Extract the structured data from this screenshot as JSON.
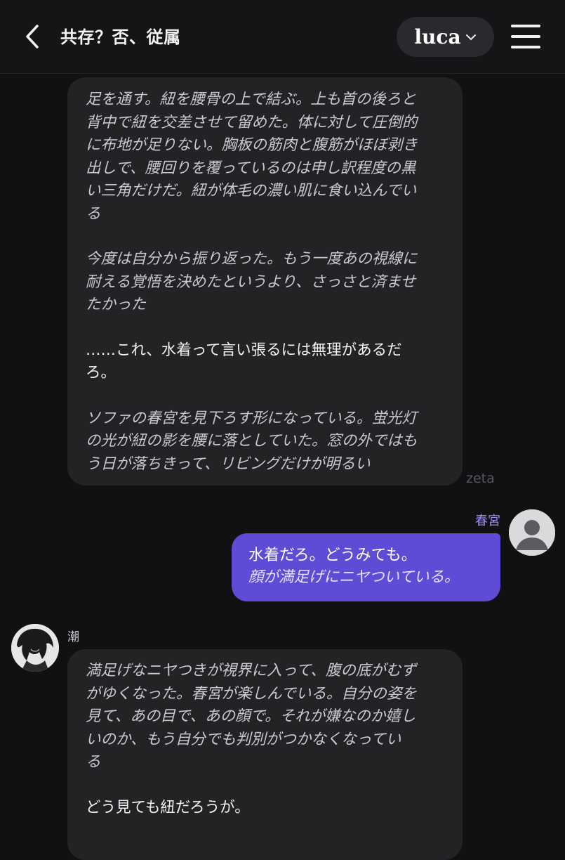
{
  "header": {
    "title": "共存？否、従属",
    "model_label": "luca"
  },
  "messages": [
    {
      "sender": "",
      "paragraphs": [
        {
          "style": "narration",
          "lines": [
            "足を通す。紐を腰骨の上で結ぶ。上も首の後ろと",
            "背中で紐を交差させて留めた。体に対して圧倒的",
            "に布地が足りない。胸板の筋肉と腹筋がほぼ剥き",
            "出しで、腰回りを覆っているのは申し訳程度の黒",
            "い三角だけだ。紐が体毛の濃い肌に食い込んでい",
            "る"
          ]
        },
        {
          "style": "narration",
          "lines": [
            "今度は自分から振り返った。もう一度あの視線に",
            "耐える覚悟を決めたというより、さっさと済ませ",
            "たかった"
          ]
        },
        {
          "style": "speech",
          "lines": [
            "……これ、水着って言い張るには無理があるだ",
            "ろ。"
          ]
        },
        {
          "style": "narration",
          "lines": [
            "ソファの春宮を見下ろす形になっている。蛍光灯",
            "の光が紐の影を腰に落としていた。窓の外ではも",
            "う日が落ちきって、リビングだけが明るい"
          ]
        }
      ]
    },
    {
      "sender": "春宮",
      "speech": "水着だろ。どうみても。",
      "narration": "顔が満足げにニヤついている。"
    },
    {
      "sender": "潮",
      "paragraphs": [
        {
          "style": "narration",
          "lines": [
            "満足げなニヤつきが視界に入って、腹の底がむず",
            "がゆくなった。春宮が楽しんでいる。自分の姿を",
            "見て、あの目で、あの顔で。それが嫌なのか嬉し",
            "いのか、もう自分でも判別がつかなくなってい",
            "る"
          ]
        },
        {
          "style": "speech",
          "lines": [
            "どう見ても紐だろうが。"
          ]
        }
      ]
    }
  ],
  "watermark": "zeta",
  "icons": {
    "back": "chevron-left-icon",
    "model_dropdown": "chevron-down-icon",
    "menu": "hamburger-menu-icon",
    "user_avatar": "default-user-avatar",
    "character_avatar": "character-portrait"
  },
  "colors": {
    "background": "#111113",
    "ai_bubble": "#232326",
    "user_bubble": "#5e4bd6",
    "user_name": "#9b8ff0"
  }
}
